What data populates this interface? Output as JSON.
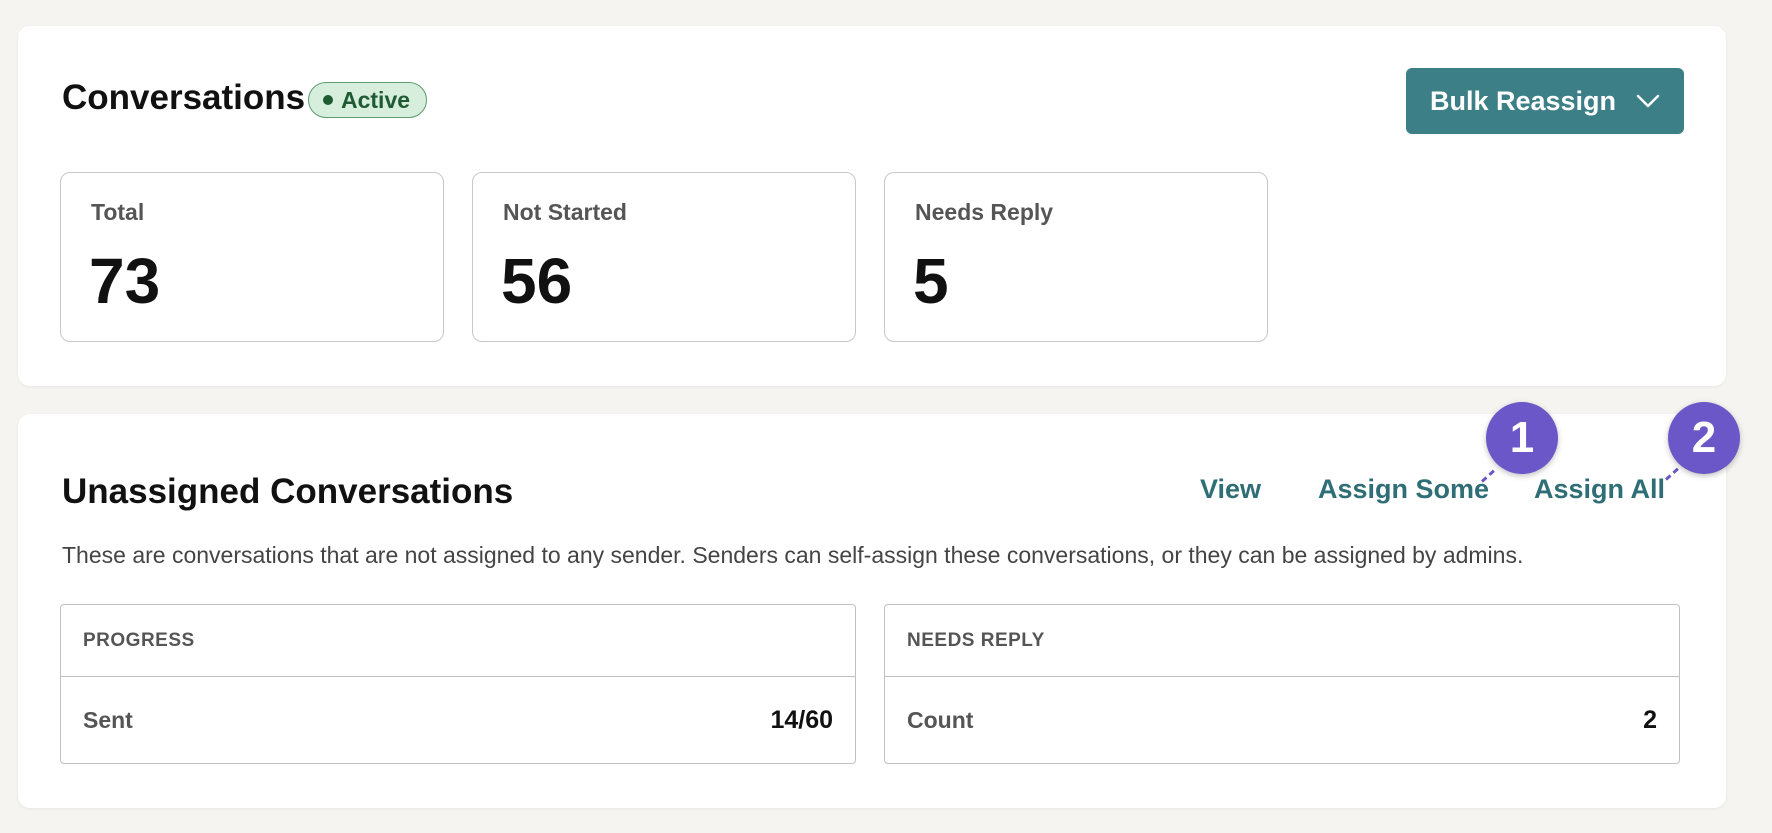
{
  "conversations": {
    "title": "Conversations",
    "status": "Active",
    "bulk_button_label": "Bulk Reassign",
    "stats": [
      {
        "label": "Total",
        "value": "73"
      },
      {
        "label": "Not Started",
        "value": "56"
      },
      {
        "label": "Needs Reply",
        "value": "5"
      }
    ]
  },
  "unassigned": {
    "title": "Unassigned Conversations",
    "actions": {
      "view": "View",
      "assign_some": "Assign Some",
      "assign_all": "Assign All"
    },
    "description": "These are conversations that are not assigned to any sender. Senders can self-assign these conversations, or they can be assigned by admins.",
    "progress": {
      "header": "PROGRESS",
      "row_label": "Sent",
      "row_value": "14/60"
    },
    "needs_reply": {
      "header": "NEEDS REPLY",
      "row_label": "Count",
      "row_value": "2"
    }
  },
  "markers": [
    "1",
    "2"
  ],
  "colors": {
    "accent": "#3d7f86",
    "link": "#2f6e76",
    "badge_bg": "#d6eedb",
    "badge_text": "#1f5a33",
    "marker": "#6b57c7",
    "page_bg": "#f6f4f0"
  }
}
